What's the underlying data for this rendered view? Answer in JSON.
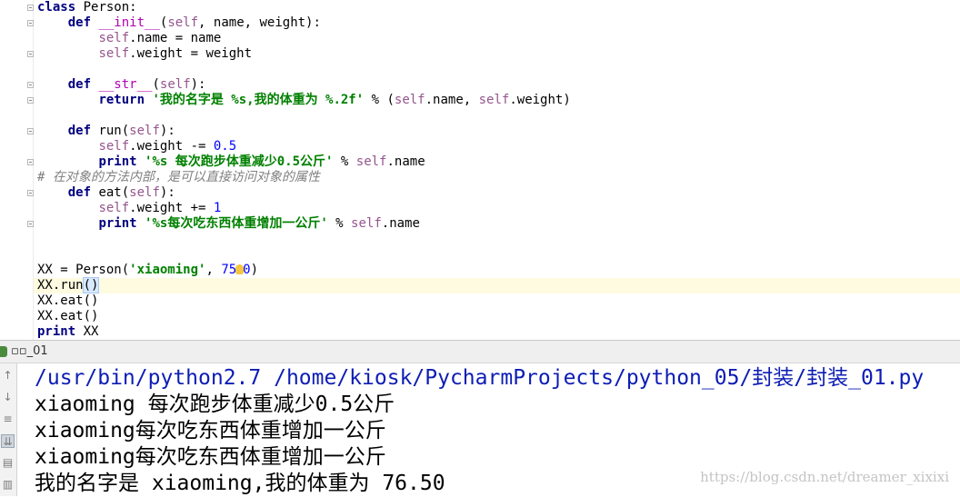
{
  "editor": {
    "lines": [
      [
        {
          "t": "class",
          "c": "kw"
        },
        {
          "t": " Person:"
        }
      ],
      [
        {
          "t": "    "
        },
        {
          "t": "def",
          "c": "kw"
        },
        {
          "t": " "
        },
        {
          "t": "__init__",
          "c": "dunder"
        },
        {
          "t": "("
        },
        {
          "t": "self",
          "c": "self"
        },
        {
          "t": ", name, weight):"
        }
      ],
      [
        {
          "t": "        "
        },
        {
          "t": "self",
          "c": "self"
        },
        {
          "t": ".name = name"
        }
      ],
      [
        {
          "t": "        "
        },
        {
          "t": "self",
          "c": "self"
        },
        {
          "t": ".weight = weight"
        }
      ],
      [],
      [
        {
          "t": "    "
        },
        {
          "t": "def",
          "c": "kw"
        },
        {
          "t": " "
        },
        {
          "t": "__str__",
          "c": "dunder"
        },
        {
          "t": "("
        },
        {
          "t": "self",
          "c": "self"
        },
        {
          "t": "):"
        }
      ],
      [
        {
          "t": "        "
        },
        {
          "t": "return",
          "c": "kw"
        },
        {
          "t": " "
        },
        {
          "t": "'我的名字是 %s,我的体重为 %.2f'",
          "c": "str"
        },
        {
          "t": " % ("
        },
        {
          "t": "self",
          "c": "self"
        },
        {
          "t": ".name, "
        },
        {
          "t": "self",
          "c": "self"
        },
        {
          "t": ".weight)"
        }
      ],
      [],
      [
        {
          "t": "    "
        },
        {
          "t": "def",
          "c": "kw"
        },
        {
          "t": " run("
        },
        {
          "t": "self",
          "c": "self"
        },
        {
          "t": "):"
        }
      ],
      [
        {
          "t": "        "
        },
        {
          "t": "self",
          "c": "self"
        },
        {
          "t": ".weight -= "
        },
        {
          "t": "0.5",
          "c": "num"
        }
      ],
      [
        {
          "t": "        "
        },
        {
          "t": "print",
          "c": "kw"
        },
        {
          "t": " "
        },
        {
          "t": "'%s 每次跑步体重减少0.5公斤'",
          "c": "str"
        },
        {
          "t": " % "
        },
        {
          "t": "self",
          "c": "self"
        },
        {
          "t": ".name"
        }
      ],
      [
        {
          "t": "# 在对象的方法内部，是可以直接访问对象的属性",
          "c": "cmt"
        }
      ],
      [
        {
          "t": "    "
        },
        {
          "t": "def",
          "c": "kw"
        },
        {
          "t": " eat("
        },
        {
          "t": "self",
          "c": "self"
        },
        {
          "t": "):"
        }
      ],
      [
        {
          "t": "        "
        },
        {
          "t": "self",
          "c": "self"
        },
        {
          "t": ".weight += "
        },
        {
          "t": "1",
          "c": "num"
        }
      ],
      [
        {
          "t": "        "
        },
        {
          "t": "print",
          "c": "kw"
        },
        {
          "t": " "
        },
        {
          "t": "'%s每次吃东西体重增加一公斤'",
          "c": "str"
        },
        {
          "t": " % "
        },
        {
          "t": "self",
          "c": "self"
        },
        {
          "t": ".name"
        }
      ],
      [],
      [],
      [
        {
          "t": "XX = Person("
        },
        {
          "t": "'xiaoming'",
          "c": "str"
        },
        {
          "t": ", "
        },
        {
          "t": "75",
          "c": "num"
        },
        {
          "bulb": true
        },
        {
          "t": "0",
          "c": "num"
        },
        {
          "t": ")"
        }
      ],
      [
        {
          "t": "XX.run"
        },
        {
          "t": "()",
          "c": "cursor-hl"
        }
      ],
      [
        {
          "t": "XX.eat()"
        }
      ],
      [
        {
          "t": "XX.eat()"
        }
      ],
      [
        {
          "t": "print",
          "c": "kw"
        },
        {
          "t": " XX"
        }
      ]
    ],
    "current_line": 18
  },
  "run_panel": {
    "title": "▫▫_01",
    "toolbar_icons": [
      "arrow-up-icon",
      "arrow-down-icon",
      "soft-wrap-icon",
      "scroll-to-end-icon",
      "print-icon",
      "trash-icon"
    ],
    "output": [
      "/usr/bin/python2.7 /home/kiosk/PycharmProjects/python_05/封装/封装_01.py",
      "xiaoming 每次跑步体重减少0.5公斤",
      "xiaoming每次吃东西体重增加一公斤",
      "xiaoming每次吃东西体重增加一公斤",
      "我的名字是 xiaoming,我的体重为 76.50"
    ]
  },
  "watermark": "https://blog.csdn.net/dreamer_xixixi",
  "colors": {
    "keyword": "#000080",
    "string": "#008000",
    "self": "#94558d",
    "number": "#0000ff",
    "path": "#0d1db4"
  }
}
